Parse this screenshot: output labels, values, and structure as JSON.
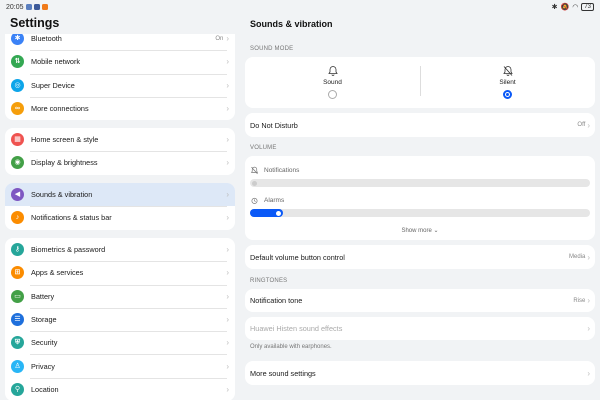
{
  "statusbar": {
    "time": "20:05",
    "battery": "73"
  },
  "left": {
    "title": "Settings",
    "groups": [
      {
        "items": [
          {
            "label": "Bluetooth",
            "value": "On",
            "icon": "bluetooth-icon",
            "color": "#3b82f6"
          },
          {
            "label": "Mobile network",
            "value": "",
            "icon": "signal-icon",
            "color": "#34a853"
          },
          {
            "label": "Super Device",
            "value": "",
            "icon": "super-device-icon",
            "color": "#0ea5e9"
          },
          {
            "label": "More connections",
            "value": "",
            "icon": "link-icon",
            "color": "#f59e0b"
          }
        ]
      },
      {
        "items": [
          {
            "label": "Home screen & style",
            "value": "",
            "icon": "home-screen-icon",
            "color": "#ef5350"
          },
          {
            "label": "Display & brightness",
            "value": "",
            "icon": "eye-icon",
            "color": "#43a047"
          }
        ]
      },
      {
        "items": [
          {
            "label": "Sounds & vibration",
            "value": "",
            "icon": "speaker-icon",
            "color": "#7e57c2",
            "active": true
          },
          {
            "label": "Notifications & status bar",
            "value": "",
            "icon": "bell-icon",
            "color": "#fb8c00"
          }
        ]
      },
      {
        "items": [
          {
            "label": "Biometrics & password",
            "value": "",
            "icon": "key-icon",
            "color": "#26a69a"
          },
          {
            "label": "Apps & services",
            "value": "",
            "icon": "apps-icon",
            "color": "#fb8c00"
          },
          {
            "label": "Battery",
            "value": "",
            "icon": "battery-icon",
            "color": "#43a047"
          },
          {
            "label": "Storage",
            "value": "",
            "icon": "storage-icon",
            "color": "#1e6fdc"
          },
          {
            "label": "Security",
            "value": "",
            "icon": "shield-icon",
            "color": "#26a69a"
          },
          {
            "label": "Privacy",
            "value": "",
            "icon": "privacy-icon",
            "color": "#29b6f6"
          },
          {
            "label": "Location",
            "value": "",
            "icon": "location-icon",
            "color": "#26a69a"
          }
        ]
      }
    ]
  },
  "right": {
    "title": "Sounds & vibration",
    "sound_mode_label": "SOUND MODE",
    "mode_sound": "Sound",
    "mode_silent": "Silent",
    "selected_mode": "Silent",
    "dnd_label": "Do Not Disturb",
    "dnd_value": "Off",
    "volume_label": "VOLUME",
    "notifications_label": "Notifications",
    "notifications_level": 0,
    "alarms_label": "Alarms",
    "alarms_level": 0.08,
    "show_more": "Show more",
    "default_volume_label": "Default volume button control",
    "default_volume_value": "Media",
    "ringtones_label": "RINGTONES",
    "notification_tone_label": "Notification tone",
    "notification_tone_value": "Rise",
    "histen_label": "Huawei Histen sound effects",
    "histen_note": "Only available with earphones.",
    "more_sound_label": "More sound settings"
  },
  "colors": {
    "accent": "#0a59f7",
    "background": "#f1f3f5",
    "active_row": "#dde8f7"
  }
}
